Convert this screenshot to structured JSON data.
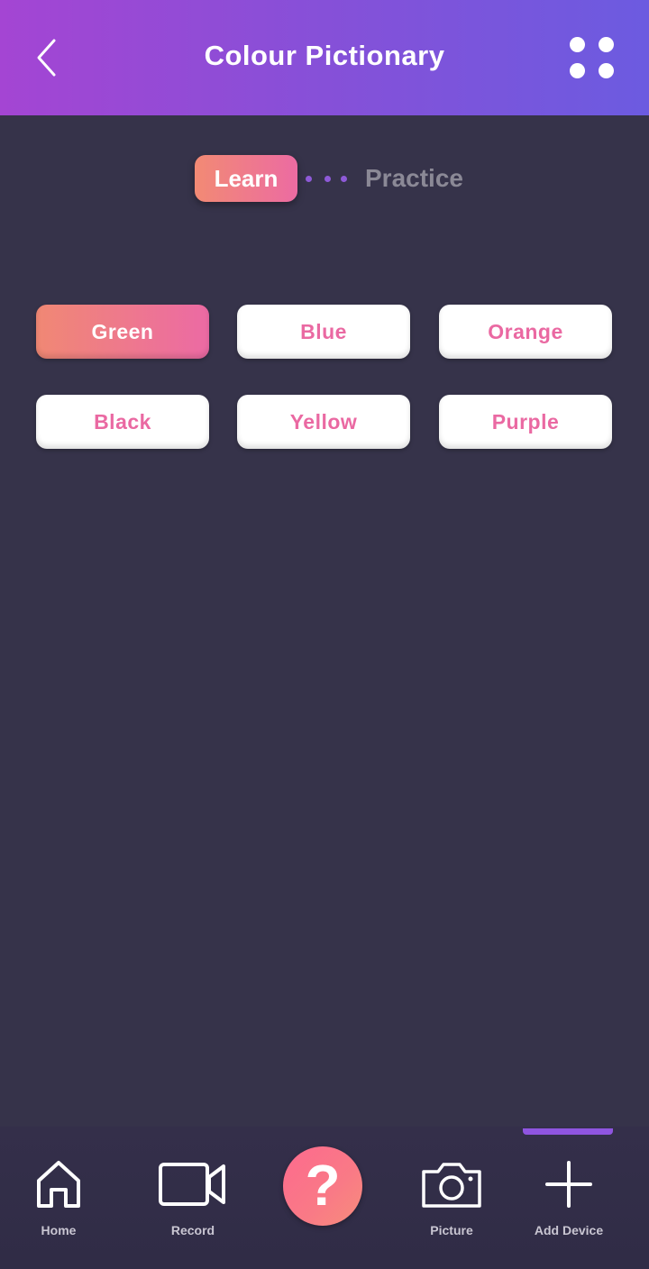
{
  "header": {
    "title": "Colour Pictionary",
    "back_icon": "chevron-left-icon",
    "menu_icon": "grid-dots-icon",
    "gradient": [
      "#a445d3",
      "#6c5be0"
    ]
  },
  "tabs": {
    "learn": "Learn",
    "practice": "Practice",
    "active": "Learn"
  },
  "colours": [
    {
      "label": "Green",
      "selected": true
    },
    {
      "label": "Blue",
      "selected": false
    },
    {
      "label": "Orange",
      "selected": false
    },
    {
      "label": "Black",
      "selected": false
    },
    {
      "label": "Yellow",
      "selected": false
    },
    {
      "label": "Purple",
      "selected": false
    }
  ],
  "bottom_nav": {
    "items": [
      {
        "label": "Home",
        "icon": "home-icon"
      },
      {
        "label": "Record",
        "icon": "video-camera-icon"
      },
      {
        "label": "",
        "icon": "help-icon",
        "glyph": "?"
      },
      {
        "label": "Picture",
        "icon": "camera-icon"
      },
      {
        "label": "Add Device",
        "icon": "plus-icon",
        "active": true
      }
    ]
  },
  "colors": {
    "background": "#36334a",
    "accent_pink": "#ea69a2",
    "accent_orange": "#f28a74",
    "indicator": "#8f55e0"
  }
}
